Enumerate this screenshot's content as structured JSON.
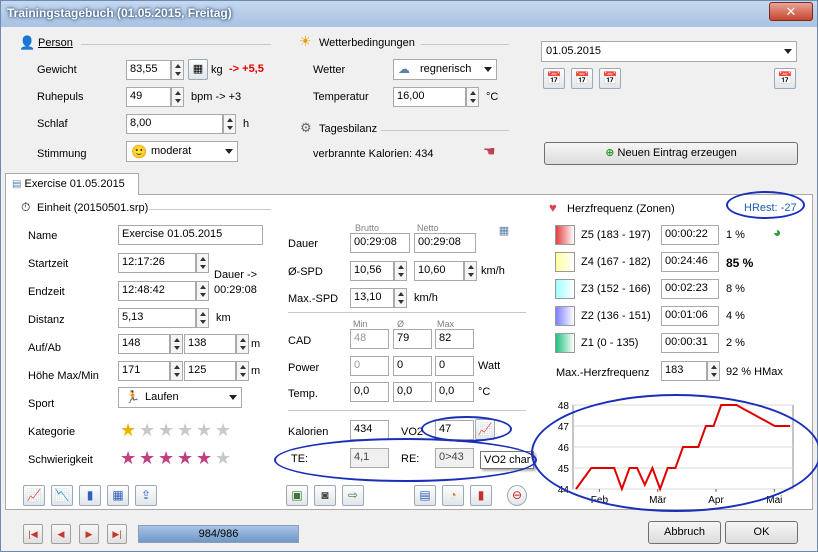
{
  "window": {
    "title": "Trainingstagebuch (01.05.2015, Freitag)"
  },
  "person": {
    "title": "Person",
    "weight": {
      "label": "Gewicht",
      "value": "83,55",
      "unit": "kg",
      "delta": "-> +5,5"
    },
    "pulse": {
      "label": "Ruhepuls",
      "value": "49",
      "unit": "bpm -> +3"
    },
    "sleep": {
      "label": "Schlaf",
      "value": "8,00",
      "unit": "h"
    },
    "mood": {
      "label": "Stimmung",
      "value": "moderat"
    }
  },
  "weather": {
    "title": "Wetterbedingungen",
    "weather": {
      "label": "Wetter",
      "value": "regnerisch"
    },
    "temp": {
      "label": "Temperatur",
      "value": "16,00",
      "unit": "°C"
    }
  },
  "balance": {
    "title": "Tagesbilanz",
    "calories": "verbrannte Kalorien: 434"
  },
  "date": {
    "value": "01.05.2015"
  },
  "new_entry_label": "Neuen Eintrag erzeugen",
  "tab_label": "Exercise 01.05.2015",
  "unit": {
    "title": "Einheit (20150501.srp)",
    "name": {
      "label": "Name",
      "value": "Exercise 01.05.2015"
    },
    "start": {
      "label": "Startzeit",
      "value": "12:17:26"
    },
    "end": {
      "label": "Endzeit",
      "value": "12:48:42"
    },
    "duration_note": "Dauer ->",
    "duration_value": "00:29:08",
    "distance": {
      "label": "Distanz",
      "value": "5,13",
      "unit": "km"
    },
    "updown": {
      "label": "Auf/Ab",
      "up": "148",
      "down": "138",
      "unit": "m"
    },
    "height": {
      "label": "Höhe Max/Min",
      "max": "171",
      "min": "125",
      "unit": "m"
    },
    "sport": {
      "label": "Sport",
      "value": "Laufen"
    },
    "category": {
      "label": "Kategorie",
      "stars": 1
    },
    "difficulty": {
      "label": "Schwierigkeit",
      "stars": 5
    }
  },
  "stats": {
    "brutto": "Brutto",
    "netto": "Netto",
    "duration": {
      "label": "Dauer",
      "brutto": "00:29:08",
      "netto": "00:29:08"
    },
    "avg_speed": {
      "label": "Ø-SPD",
      "brutto": "10,56",
      "netto": "10,60",
      "unit": "km/h"
    },
    "max_speed": {
      "label": "Max.-SPD",
      "value": "13,10",
      "unit": "km/h"
    },
    "col_min": "Min",
    "col_avg": "Ø",
    "col_max": "Max",
    "cad": {
      "label": "CAD",
      "min": "48",
      "avg": "79",
      "max": "82"
    },
    "power": {
      "label": "Power",
      "min": "0",
      "avg": "0",
      "max": "0",
      "unit": "Watt"
    },
    "temp": {
      "label": "Temp.",
      "min": "0,0",
      "avg": "0,0",
      "max": "0,0",
      "unit": "°C"
    },
    "calories": {
      "label": "Kalorien",
      "value": "434"
    },
    "vo2": {
      "label": "VO2",
      "value": "47"
    },
    "te": {
      "label": "TE:",
      "value": "4,1"
    },
    "re": {
      "label": "RE:",
      "value": "0>43"
    },
    "tooltip": "VO2 char"
  },
  "hr": {
    "title": "Herzfrequenz (Zonen)",
    "hrest": "HRest: -27",
    "zones": [
      {
        "label": "Z5 (183 - 197)",
        "time": "00:00:22",
        "pct": "1 %",
        "color": "#e04040",
        "bold": false
      },
      {
        "label": "Z4 (167 - 182)",
        "time": "00:24:46",
        "pct": "85 %",
        "color": "#ffffa0",
        "bold": true
      },
      {
        "label": "Z3 (152 - 166)",
        "time": "00:02:23",
        "pct": "8 %",
        "color": "#a0ffff",
        "bold": false
      },
      {
        "label": "Z2 (136 - 151)",
        "time": "00:01:06",
        "pct": "4 %",
        "color": "#8080ff",
        "bold": false
      },
      {
        "label": "Z1 (0 - 135)",
        "time": "00:00:31",
        "pct": "2 %",
        "color": "#20c080",
        "bold": false
      }
    ],
    "max": {
      "label": "Max.-Herzfrequenz",
      "value": "183",
      "pct": "92 % HMax"
    }
  },
  "chart_data": {
    "type": "line",
    "title": "",
    "xlabel": "",
    "ylabel": "",
    "x_ticks": [
      "Feb",
      "Mär",
      "Apr",
      "Mai"
    ],
    "y_ticks": [
      44,
      45,
      46,
      47,
      48
    ],
    "ylim": [
      44,
      48
    ],
    "color": "#e00000",
    "series": [
      {
        "values": [
          44,
          44.5,
          45,
          45,
          45,
          45,
          44,
          45,
          45,
          44.2,
          45,
          44,
          45,
          45,
          46,
          46,
          46,
          47,
          47,
          48,
          48,
          48,
          47.8,
          47.6,
          47.4,
          47.2,
          47,
          47,
          47
        ]
      }
    ]
  },
  "nav": {
    "progress": "984/986",
    "progress_fraction": 0.998
  },
  "buttons": {
    "cancel": "Abbruch",
    "ok": "OK"
  }
}
